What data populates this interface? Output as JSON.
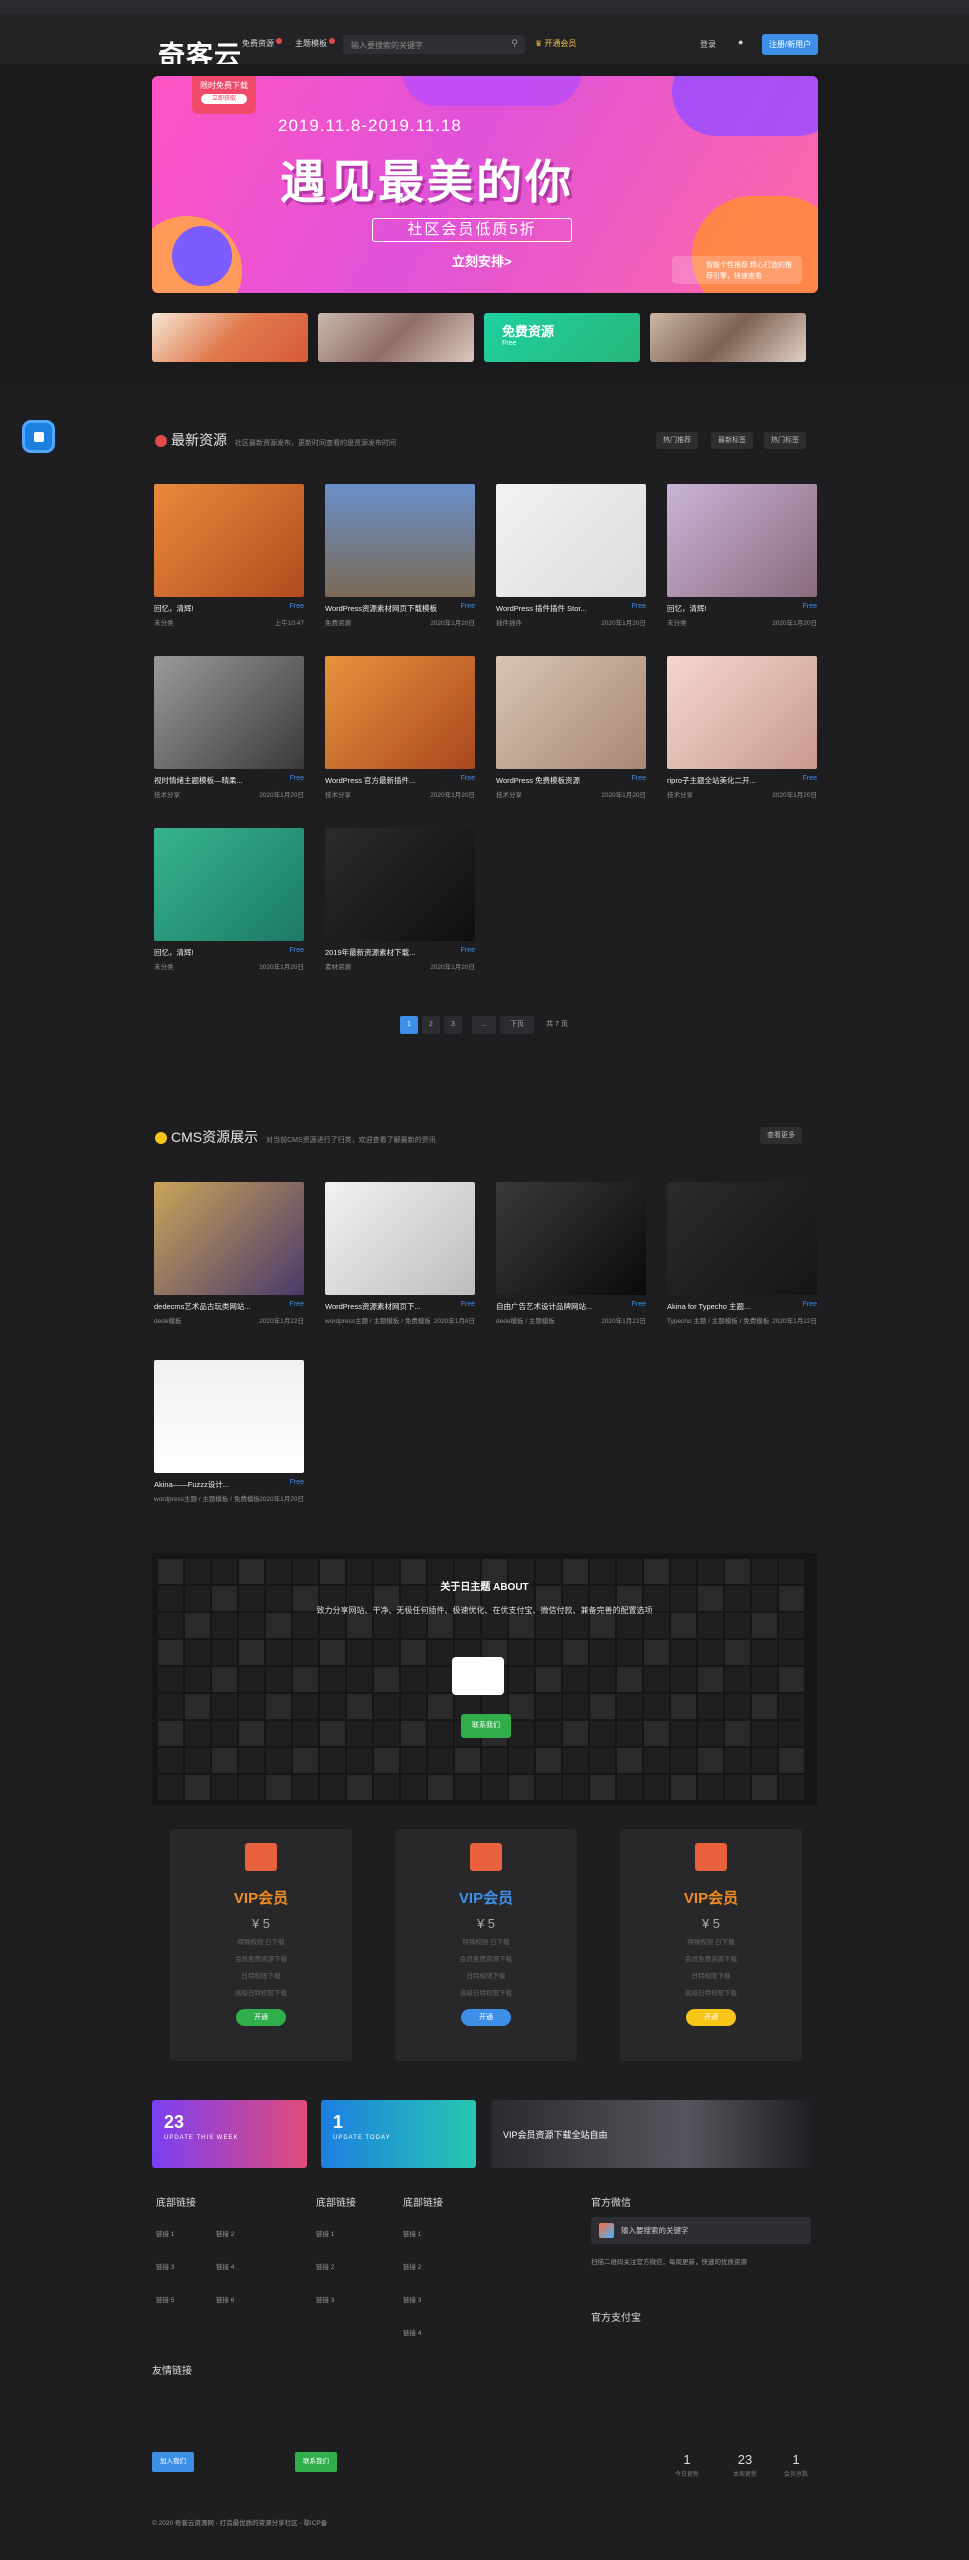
{
  "header": {
    "logo": "奇客云",
    "nav": [
      "免费资源",
      "主题模板"
    ],
    "search_placeholder": "输入要搜索的关键字",
    "vip_link": "开通会员",
    "login": "登录",
    "register": "注册/新用户"
  },
  "banner": {
    "tag": "限时免费下载",
    "tag_btn": "立即获取",
    "date": "2019.11.8-2019.11.18",
    "headline": "遇见最美的你",
    "subline": "社区会员低质5折",
    "cta": "立刻安排>",
    "promo": "智能个性推荐 精心打造的推荐引擎，快速查看"
  },
  "thumbs": {
    "free_title": "免费资源",
    "free_sub": "Free"
  },
  "latest": {
    "title": "最新资源",
    "subtitle": "社区最新资源发布，更新时间查看的是资源发布时间",
    "chips": [
      "热门推荐",
      "最新标签",
      "热门标签"
    ],
    "cards": [
      {
        "title": "回忆，清辉!",
        "tag": "Free",
        "cat": "未分类",
        "date": "上午10:47"
      },
      {
        "title": "WordPress资源素材网页下载模板",
        "tag": "Free",
        "cat": "免费资源",
        "date": "2020年1月20日"
      },
      {
        "title": "WordPress 插件插件 Stor...",
        "tag": "Free",
        "cat": "插件插件",
        "date": "2020年1月20日"
      },
      {
        "title": "回忆，清辉!",
        "tag": "Free",
        "cat": "未分类",
        "date": "2020年1月20日"
      },
      {
        "title": "视时情绪主题模板—晴柔...",
        "tag": "Free",
        "cat": "技术分享",
        "date": "2020年1月20日"
      },
      {
        "title": "WordPress 官方最新插件...",
        "tag": "Free",
        "cat": "技术分享",
        "date": "2020年1月20日"
      },
      {
        "title": "WordPress 免费模板资源",
        "tag": "Free",
        "cat": "技术分享",
        "date": "2020年1月20日"
      },
      {
        "title": "ripro子主题全站美化二开...",
        "tag": "Free",
        "cat": "技术分享",
        "date": "2020年1月20日"
      },
      {
        "title": "回忆，清辉!",
        "tag": "Free",
        "cat": "未分类",
        "date": "2020年1月20日"
      },
      {
        "title": "2019年最新资源素材下载...",
        "tag": "Free",
        "cat": "素材资源",
        "date": "2020年1月20日"
      }
    ]
  },
  "pager": {
    "pages": [
      "1",
      "2",
      "3",
      "..."
    ],
    "next": "下页",
    "total": "共 7 页"
  },
  "cms": {
    "title": "CMS资源展示",
    "subtitle": "对当前CMS资源进行了归类，欢迎查看了解最新的资讯",
    "chip": "查看更多",
    "cards": [
      {
        "title": "dedecms艺术品古玩类网站...",
        "tag": "Free",
        "cat": "dede模板",
        "date": "2020年1月22日"
      },
      {
        "title": "WordPress资源素材网页下...",
        "tag": "Free",
        "cat": "wordpress主题 / 主题模板 / 免费模板",
        "date": "2020年1月8日"
      },
      {
        "title": "自由广告艺术设计品牌网站...",
        "tag": "Free",
        "cat": "dede模板 / 主题模板",
        "date": "2020年1月22日"
      },
      {
        "title": "Akina for Typecho 主题...",
        "tag": "Free",
        "cat": "Typecho 主题 / 主题模板 / 免费模板",
        "date": "2020年1月22日"
      },
      {
        "title": "Akina——Fuzzz设计...",
        "tag": "Free",
        "cat": "wordpress主题 / 主题模板 / 免费模板",
        "date": "2020年1月20日"
      }
    ]
  },
  "about": {
    "title": "关于日主题 ABOUT",
    "text": "致力分享网站、干净、无极任何插件、极速优化、在优支付宝、微信付款、兼备完善的配置选项",
    "button": "联系我们"
  },
  "vip": [
    {
      "name": "VIP会员",
      "price": "5",
      "lines": [
        "特殊权限 日下载",
        "会员免费资源下载",
        "日特权限下载",
        "高级日特权限下载"
      ],
      "btn": "开通",
      "color": "#f08b25",
      "btncolor": "#2fae4a"
    },
    {
      "name": "VIP会员",
      "price": "5",
      "lines": [
        "特殊权限 日下载",
        "会员免费资源下载",
        "日特权限下载",
        "高级日特权限下载"
      ],
      "btn": "开通",
      "color": "#3d8fe8",
      "btncolor": "#3d8fe8"
    },
    {
      "name": "VIP会员",
      "price": "5",
      "lines": [
        "特殊权限 日下载",
        "会员免费资源下载",
        "日特权限下载",
        "高级日特权限下载"
      ],
      "btn": "开通",
      "color": "#f08b25",
      "btncolor": "#f5c518"
    }
  ],
  "ads": [
    {
      "num": "23",
      "sub": "UPDATE THIS WEEK"
    },
    {
      "num": "1",
      "sub": "UPDATE TODAY"
    },
    {
      "text": "VIP会员资源下载全站自由"
    }
  ],
  "footer": {
    "col1": "底部链接",
    "col2": "底部链接",
    "col3": "底部链接",
    "col4": "官方微信",
    "links1": [
      "链接 1",
      "链接 2",
      "链接 3",
      "链接 4",
      "链接 5",
      "链接 6"
    ],
    "links2": [
      "链接 1",
      "链接 2",
      "链接 3"
    ],
    "links3": [
      "链接 1",
      "链接 2",
      "链接 3",
      "链接 4"
    ],
    "wx_placeholder": "输入要搜索的关键字",
    "wx_text": "扫描二维码关注官方微信，每周更新，快速的优质资源",
    "follow": "官方支付宝",
    "friends": "友情链接",
    "btn1": "加入我们",
    "btn2": "联系我们",
    "stat1": "1",
    "stat2": "23",
    "stat3": "1",
    "stat1l": "今日更新",
    "stat2l": "本周更新",
    "stat3l": "会员总数",
    "copyright": "© 2020 奇客云资源网 - 打造最优质的资源分享社区 - 鄂ICP备"
  }
}
